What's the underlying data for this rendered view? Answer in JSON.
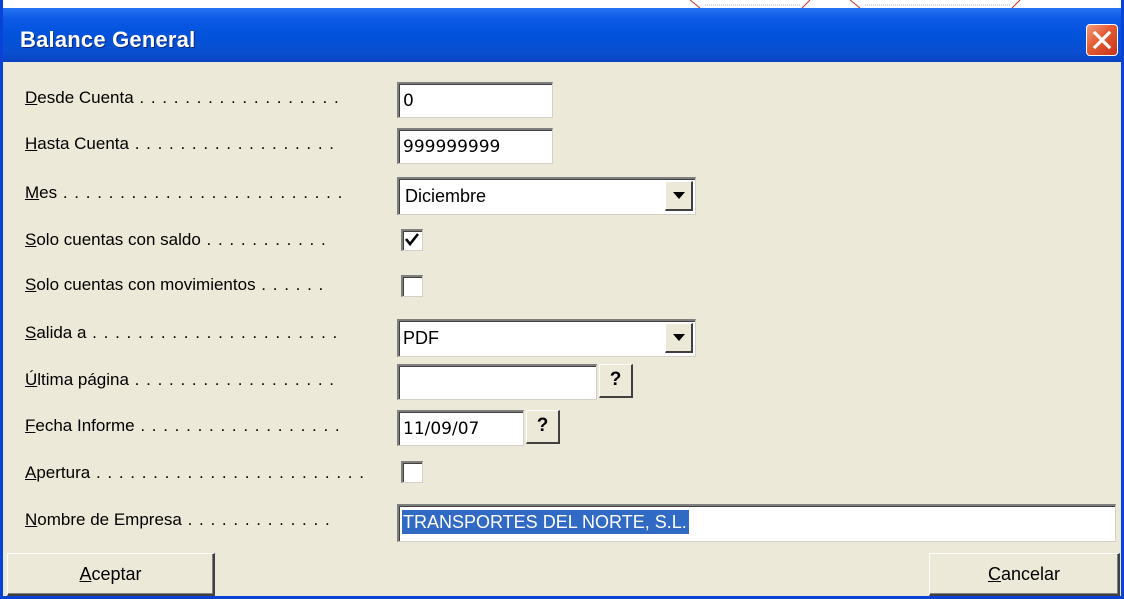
{
  "window": {
    "title": "Balance General",
    "close_symbol": "×"
  },
  "fields": {
    "desde_cuenta": {
      "label_hotkey": "D",
      "label_rest": "esde Cuenta",
      "dots": " . . . . . . . . . . . . . . . . . . ",
      "value": "0"
    },
    "hasta_cuenta": {
      "label_hotkey": "H",
      "label_rest": "asta Cuenta",
      "dots": " . . . . . . . . . . . . . . . . . . ",
      "value": "999999999"
    },
    "mes": {
      "label_hotkey": "M",
      "label_rest": "es",
      "dots": " . . . . . . . . . . . . . . . . . . . . . . . . . ",
      "value": "Diciembre"
    },
    "solo_saldo": {
      "label_hotkey": "S",
      "label_rest": "olo cuentas con saldo",
      "dots": " . . . . . . . . . . . ",
      "checked": true
    },
    "solo_movimientos": {
      "label_hotkey": "S",
      "label_rest": "olo cuentas con movimientos",
      "dots": " . . . . . . ",
      "checked": false
    },
    "salida": {
      "label_hotkey": "S",
      "label_rest": "alida a",
      "dots": " . . . . . . . . . . . . . . . . . . . . . . ",
      "value": "PDF"
    },
    "ultima_pagina": {
      "label_hotkey": "Ú",
      "label_rest": "ltima página",
      "dots": " . . . . . . . . . . . . . . . . . . ",
      "value": "",
      "help": "?"
    },
    "fecha_informe": {
      "label_hotkey": "F",
      "label_rest": "echa Informe",
      "dots": " . . . . . . . . . . . . . . . . . . ",
      "value": "11/09/07",
      "help": "?"
    },
    "apertura": {
      "label_hotkey": "A",
      "label_rest": "pertura",
      "dots": " . . . . . . . . . . . . . . . . . . . . . . . . ",
      "checked": false
    },
    "nombre_empresa": {
      "label_hotkey": "N",
      "label_rest": "ombre de Empresa",
      "dots": " . . . . . . . . . . . . . ",
      "value": "TRANSPORTES DEL NORTE, S.L."
    }
  },
  "buttons": {
    "aceptar": {
      "hotkey": "A",
      "rest": "ceptar"
    },
    "cancelar": {
      "hotkey": "C",
      "rest": "ancelar"
    }
  },
  "colors": {
    "titlebar": "#0151da",
    "dialog_bg": "#ece9d8",
    "selection": "#316ac5",
    "close_button": "#e45a32"
  }
}
